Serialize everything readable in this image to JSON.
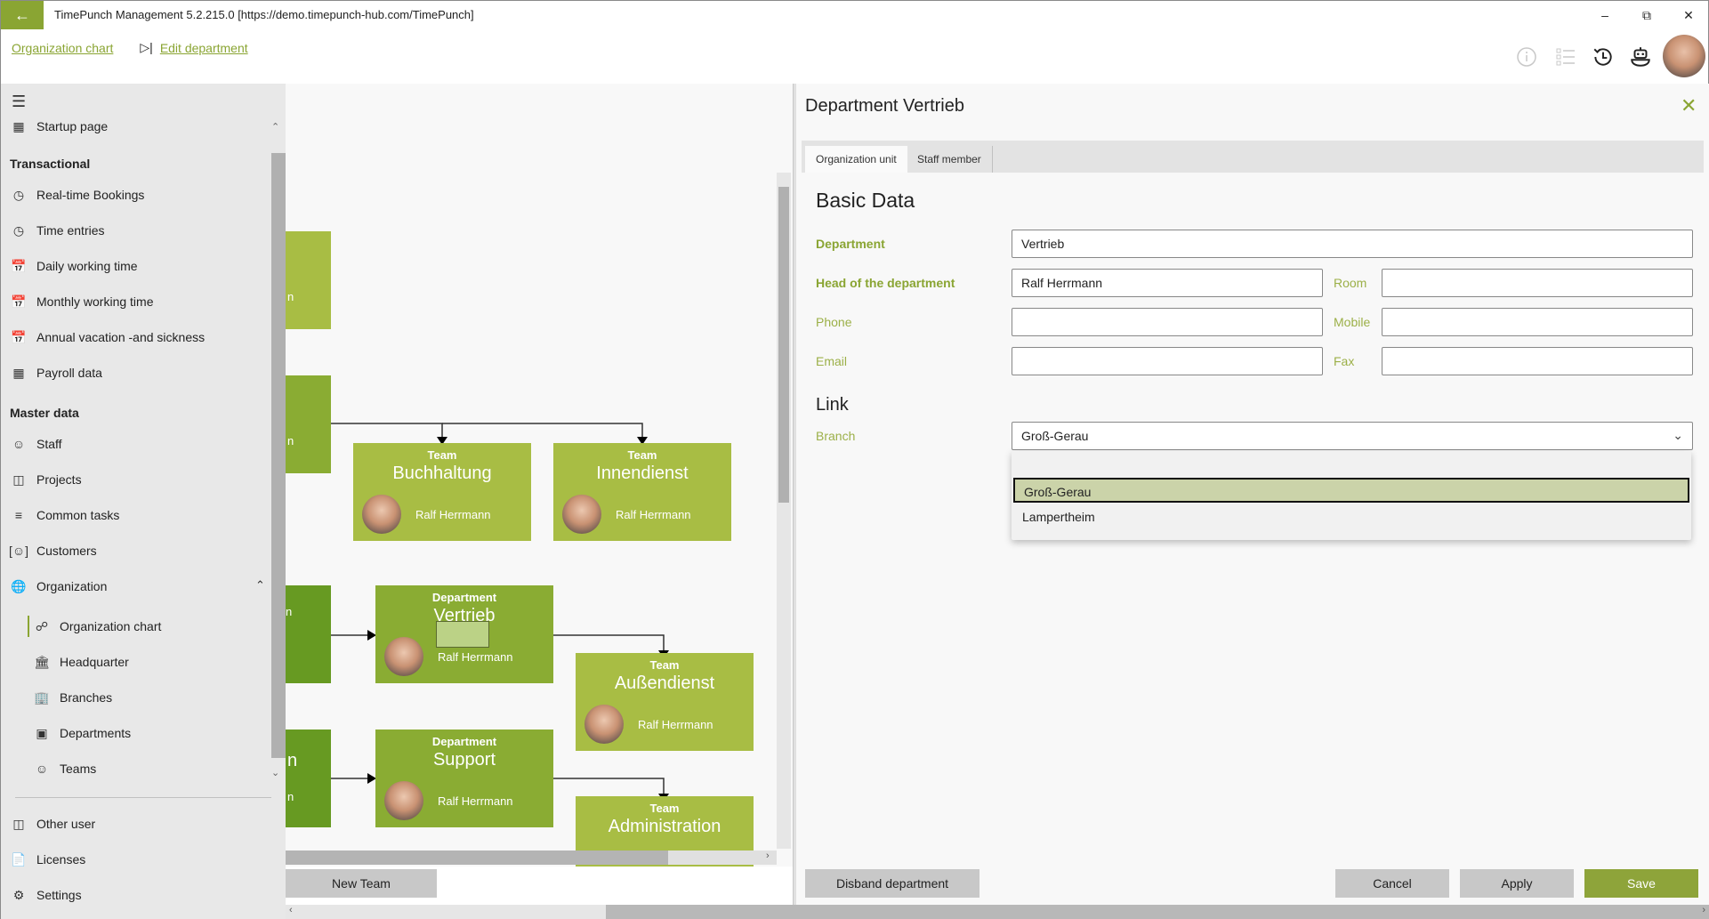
{
  "window": {
    "title": "TimePunch Management 5.2.215.0 [https://demo.timepunch-hub.com/TimePunch]",
    "controls": [
      "minimize",
      "restore",
      "close"
    ]
  },
  "breadcrumb": {
    "items": [
      "Organization chart",
      "Edit department"
    ]
  },
  "toolbar": {
    "icons": [
      "info-icon",
      "list-icon",
      "history-icon",
      "bot-icon",
      "user-avatar"
    ]
  },
  "sidebar": {
    "top_item": "Startup page",
    "sections": [
      {
        "title": "Transactional",
        "items": [
          "Real-time Bookings",
          "Time entries",
          "Daily working time",
          "Monthly working time",
          "Annual vacation -and sickness",
          "Payroll data"
        ]
      },
      {
        "title": "Master data",
        "items": [
          "Staff",
          "Projects",
          "Common tasks",
          "Customers",
          "Organization"
        ]
      }
    ],
    "organization_children": [
      "Organization chart",
      "Headquarter",
      "Branches",
      "Departments",
      "Teams"
    ],
    "active_item": "Organization chart",
    "bottom_items": [
      "Other user",
      "Licenses",
      "Settings"
    ]
  },
  "org_chart": {
    "nodes": [
      {
        "kind": "Team",
        "name": "Buchhaltung",
        "person": "Ralf Herrmann"
      },
      {
        "kind": "Team",
        "name": "Innendienst",
        "person": "Ralf Herrmann"
      },
      {
        "kind": "Department",
        "name": "Vertrieb",
        "person": "Ralf Herrmann"
      },
      {
        "kind": "Team",
        "name": "Außendienst",
        "person": "Ralf Herrmann"
      },
      {
        "kind": "Department",
        "name": "Support",
        "person": "Ralf Herrmann"
      },
      {
        "kind": "Team",
        "name": "Administration",
        "person": ""
      }
    ],
    "partial_labels": [
      "n",
      "n",
      "n",
      "n",
      "n"
    ],
    "new_team_label": "New Team"
  },
  "panel": {
    "title": "Department Vertrieb",
    "tabs": [
      "Organization unit",
      "Staff member"
    ],
    "active_tab": "Organization unit",
    "basic_data_heading": "Basic Data",
    "fields": {
      "department": {
        "label": "Department",
        "value": "Vertrieb"
      },
      "head": {
        "label": "Head of the department",
        "value": "Ralf Herrmann"
      },
      "room": {
        "label": "Room",
        "value": ""
      },
      "phone": {
        "label": "Phone",
        "value": ""
      },
      "mobile": {
        "label": "Mobile",
        "value": ""
      },
      "email": {
        "label": "Email",
        "value": ""
      },
      "fax": {
        "label": "Fax",
        "value": ""
      }
    },
    "link_heading": "Link",
    "branch": {
      "label": "Branch",
      "value": "Groß-Gerau",
      "options": [
        "",
        "Groß-Gerau",
        "Lampertheim"
      ],
      "highlighted": "Groß-Gerau"
    },
    "buttons": {
      "disband": "Disband department",
      "cancel": "Cancel",
      "apply": "Apply",
      "save": "Save"
    }
  },
  "colors": {
    "accent": "#8aa533",
    "node_light": "#a8bd44",
    "node_mid": "#8aac33",
    "node_dark": "#679a22",
    "dropdown_highlight": "#cbd3a9"
  }
}
